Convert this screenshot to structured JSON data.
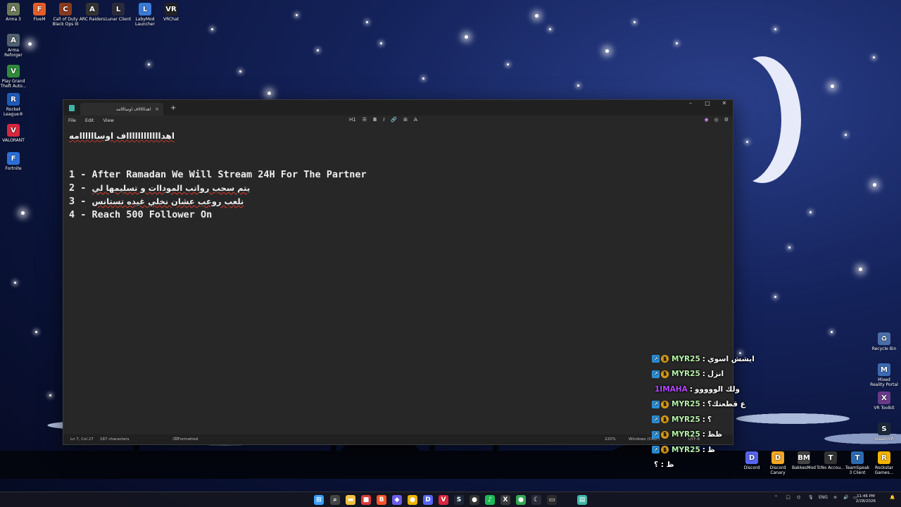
{
  "desktop_left_icons": [
    {
      "label": "Arma 3",
      "icon": "arma3-icon",
      "glyph": "A",
      "color": "#6b7a56"
    },
    {
      "label": "Arma Reforger",
      "icon": "arma-reforger-icon",
      "glyph": "A",
      "color": "#51616e"
    },
    {
      "label": "Play Grand Theft Auto...",
      "icon": "gta-icon",
      "glyph": "V",
      "color": "#2f8b3a"
    },
    {
      "label": "Rocket League®",
      "icon": "rocket-league-icon",
      "glyph": "R",
      "color": "#1e5bb8"
    },
    {
      "label": "VALORANT",
      "icon": "valorant-icon",
      "glyph": "V",
      "color": "#d7263d"
    },
    {
      "label": "Fortnite",
      "icon": "fortnite-icon",
      "glyph": "F",
      "color": "#2a6fd6"
    }
  ],
  "desktop_top_icons": [
    {
      "label": "FiveM",
      "icon": "fivem-icon",
      "glyph": "F",
      "color": "#e35d2a"
    },
    {
      "label": "Call of Duty Black Ops III",
      "icon": "cod-icon",
      "glyph": "C",
      "color": "#8a3a1b"
    },
    {
      "label": "ARC Raiders",
      "icon": "arc-raiders-icon",
      "glyph": "A",
      "color": "#333333"
    },
    {
      "label": "Lunar Client",
      "icon": "lunar-client-icon",
      "glyph": "L",
      "color": "#2a2a3a"
    },
    {
      "label": "LabyMod Launcher",
      "icon": "labymod-icon",
      "glyph": "L",
      "color": "#3a7bd5"
    },
    {
      "label": "VRChat",
      "icon": "vrchat-icon",
      "glyph": "VR",
      "color": "#222222"
    }
  ],
  "desktop_right_icons": [
    {
      "label": "Recycle Bin",
      "icon": "recycle-bin-icon",
      "glyph": "♻",
      "color": "#4a6ea8"
    },
    {
      "label": "Mixed Reality Portal",
      "icon": "mixed-reality-icon",
      "glyph": "M",
      "color": "#3d6bb3"
    },
    {
      "label": "VR Toolkit",
      "icon": "vr-toolkit-icon",
      "glyph": "X",
      "color": "#6a3a8a"
    },
    {
      "label": "SteamVR",
      "icon": "steamvr-icon",
      "glyph": "S",
      "color": "#1b2838"
    }
  ],
  "desktop_bottom_icons": [
    {
      "label": "Discord",
      "icon": "discord-icon",
      "glyph": "D",
      "color": "#5865f2"
    },
    {
      "label": "Discord Canary",
      "icon": "discord-canary-icon",
      "glyph": "D",
      "color": "#f5a623"
    },
    {
      "label": "BakkesMod",
      "icon": "bakkesmod-icon",
      "glyph": "BM",
      "color": "#444444"
    },
    {
      "label": "TcNo Accou...",
      "icon": "tcno-icon",
      "glyph": "T",
      "color": "#333333"
    },
    {
      "label": "TeamSpeak 3 Client",
      "icon": "teamspeak-icon",
      "glyph": "T",
      "color": "#2b6cb0"
    },
    {
      "label": "Rockstar Games...",
      "icon": "rockstar-icon",
      "glyph": "R",
      "color": "#f4b400"
    }
  ],
  "notepad": {
    "tab_title": "اهدااااااف اوساااامه",
    "new_tab": "+",
    "tab_close": "×",
    "menu": [
      "File",
      "Edit",
      "View"
    ],
    "toolbar": {
      "heading": "H1",
      "list": "☰",
      "bold": "B",
      "italic": "I",
      "link": "🔗",
      "table": "⊞",
      "clear": "A̶"
    },
    "window_controls": {
      "minimize": "–",
      "maximize": "□",
      "close": "✕"
    },
    "heading": "اهدااااااااااااف اوساااااامه",
    "lines": [
      {
        "num": "1",
        "sep": " - ",
        "text": "After Ramadan We Will Stream 24H For The Partner",
        "rtl": false
      },
      {
        "num": "2",
        "sep": " - ",
        "text": "يتم سحب رواتب الموداات و تسليمها لي",
        "rtl": true
      },
      {
        "num": "3",
        "sep": " - ",
        "text": "نلعب روعب عشان نخلي غيده تستانس",
        "rtl": true
      },
      {
        "num": "4",
        "sep": " - ",
        "text": "Reach 500 Follower On",
        "rtl": false
      }
    ],
    "status": {
      "position": "Ln 7, Col 27",
      "characters": "187 characters",
      "format": "Formatted",
      "zoom": "220%",
      "line_ending": "Windows (CRLF)",
      "encoding": "UTF-8"
    }
  },
  "chat": [
    {
      "user": "MYR25",
      "msg": "ايشش اسوي",
      "badges": true,
      "color": "green"
    },
    {
      "user": "MYR25",
      "msg": "انزل",
      "badges": true,
      "color": "green"
    },
    {
      "user": "1IMAHA",
      "msg": "ولك الووووو",
      "badges": false,
      "color": "purple"
    },
    {
      "user": "MYR25",
      "msg": "ع قطعتك؟",
      "badges": true,
      "color": "green"
    },
    {
      "user": "MYR25",
      "msg": "؟",
      "badges": true,
      "color": "green"
    },
    {
      "user": "MYR25",
      "msg": "ظظ",
      "badges": true,
      "color": "green"
    },
    {
      "user": "MYR25",
      "msg": "ظ",
      "badges": true,
      "color": "green"
    },
    {
      "user": "",
      "msg": "ظ : ؟",
      "badges": false,
      "color": "white"
    }
  ],
  "taskbar": {
    "apps": [
      {
        "icon": "windows-start-icon",
        "glyph": "⊞",
        "color": "#3aa0ff"
      },
      {
        "icon": "search-icon",
        "glyph": "⌕",
        "color": "#444"
      },
      {
        "icon": "file-explorer-icon",
        "glyph": "▬",
        "color": "#f3c043"
      },
      {
        "icon": "media-icon",
        "glyph": "■",
        "color": "#d93b3b"
      },
      {
        "icon": "brave-icon",
        "glyph": "B",
        "color": "#fb542b"
      },
      {
        "icon": "app-icon",
        "glyph": "◆",
        "color": "#6c5ce7"
      },
      {
        "icon": "chrome-icon",
        "glyph": "●",
        "color": "#f0b400"
      },
      {
        "icon": "discord-taskbar-icon",
        "glyph": "D",
        "color": "#5865f2"
      },
      {
        "icon": "valorant-taskbar-icon",
        "glyph": "V",
        "color": "#d7263d"
      },
      {
        "icon": "steam-icon",
        "glyph": "S",
        "color": "#1b2838"
      },
      {
        "icon": "obs-icon",
        "glyph": "●",
        "color": "#333"
      },
      {
        "icon": "spotify-icon",
        "glyph": "♪",
        "color": "#1db954"
      },
      {
        "icon": "xbox-icon",
        "glyph": "X",
        "color": "#3a3a3a"
      },
      {
        "icon": "chrome-taskbar-icon",
        "glyph": "●",
        "color": "#34a853"
      },
      {
        "icon": "lunar-taskbar-icon",
        "glyph": "☾",
        "color": "#2a2a3a"
      },
      {
        "icon": "terminal-icon",
        "glyph": "▭",
        "color": "#2a2a2a"
      },
      {
        "icon": "notepad-taskbar-icon",
        "glyph": "▤",
        "color": "#3fb6a6"
      }
    ],
    "language": "ENG",
    "time": "11:46 PM",
    "date": "2/28/2026"
  }
}
